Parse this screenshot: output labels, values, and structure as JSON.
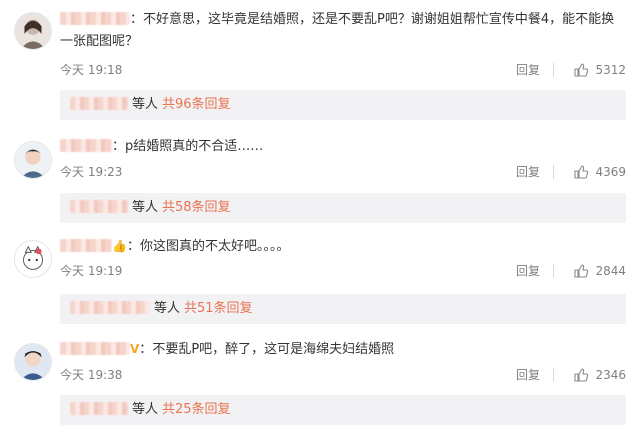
{
  "comments": [
    {
      "username_suffix": "：",
      "text": "不好意思，这毕竟是结婚照，还是不要乱P吧？谢谢姐姐帮忙宣传中餐4，能不能换一张配图呢？",
      "time": "今天 19:18",
      "reply_label": "回复",
      "likes": "5312",
      "replies_deng": "等人",
      "replies_count": "共96条回复"
    },
    {
      "username_suffix": "：",
      "text": "p结婚照真的不合适……",
      "time": "今天 19:23",
      "reply_label": "回复",
      "likes": "4369",
      "replies_deng": "等人",
      "replies_count": "共58条回复"
    },
    {
      "username_suffix": "：",
      "badge": "👍",
      "text": "你这图真的不太好吧。。。。",
      "time": "今天 19:19",
      "reply_label": "回复",
      "likes": "2844",
      "replies_deng": "等人",
      "replies_count": "共51条回复"
    },
    {
      "username_suffix": "：",
      "badge": "V",
      "text": "不要乱P吧，醉了，这可是海绵夫妇结婚照",
      "time": "今天 19:38",
      "reply_label": "回复",
      "likes": "2346",
      "replies_deng": "等人",
      "replies_count": "共25条回复"
    }
  ],
  "colors": {
    "accent": "#eb7350",
    "meta_text": "#808080",
    "replies_bg": "#f2f2f5",
    "badge_v": "#f5a623"
  },
  "icons": {
    "like": "thumbs-up-icon"
  }
}
